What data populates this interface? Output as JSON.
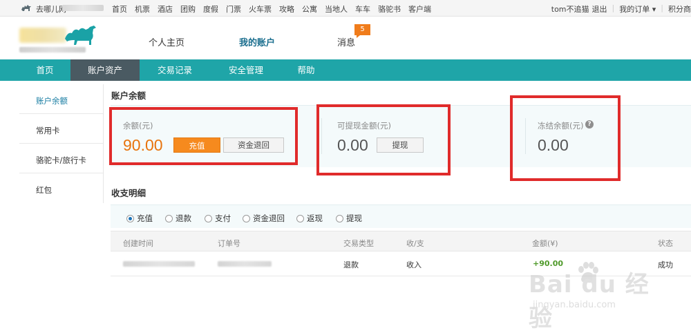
{
  "topbar": {
    "site_name": "去哪儿网",
    "nav": [
      "首页",
      "机票",
      "酒店",
      "团购",
      "度假",
      "门票",
      "火车票",
      "攻略",
      "公寓",
      "当地人",
      "车车",
      "骆驼书",
      "客户端"
    ],
    "user": "tom不追猫",
    "logout": "退出",
    "orders": "我的订单 ▾",
    "points": "积分商"
  },
  "header": {
    "nav": {
      "home": "个人主页",
      "account": "我的账户",
      "messages": "消息"
    },
    "message_count": "5"
  },
  "mainnav": [
    "首页",
    "账户资产",
    "交易记录",
    "安全管理",
    "帮助"
  ],
  "sidebar": [
    "账户余额",
    "常用卡",
    "骆驼卡/旅行卡",
    "红包"
  ],
  "balance": {
    "section_title": "账户余额",
    "balance_label": "余额(元)",
    "balance_value": "90.00",
    "recharge_btn": "充值",
    "refund_btn": "资金退回",
    "withdrawable_label": "可提现金额(元)",
    "withdrawable_value": "0.00",
    "withdraw_btn": "提现",
    "frozen_label": "冻结余额(元)",
    "frozen_value": "0.00",
    "help": "?"
  },
  "details": {
    "section_title": "收支明细",
    "filters": [
      "充值",
      "退款",
      "支付",
      "资金退回",
      "返现",
      "提现"
    ],
    "selected_filter": "充值",
    "columns": [
      "创建时间",
      "订单号",
      "交易类型",
      "收/支",
      "金额(¥)",
      "状态"
    ],
    "rows": [
      {
        "type": "退款",
        "direction": "收入",
        "amount": "+90.00",
        "status": "成功"
      }
    ]
  },
  "watermark": {
    "brand": "Bai du 经验",
    "url": "jingyan.baidu.com"
  },
  "colors": {
    "teal": "#1fa5a8",
    "orange": "#f68a1e",
    "red_highlight": "#e02b2b",
    "green_amount": "#4f9a2a"
  }
}
